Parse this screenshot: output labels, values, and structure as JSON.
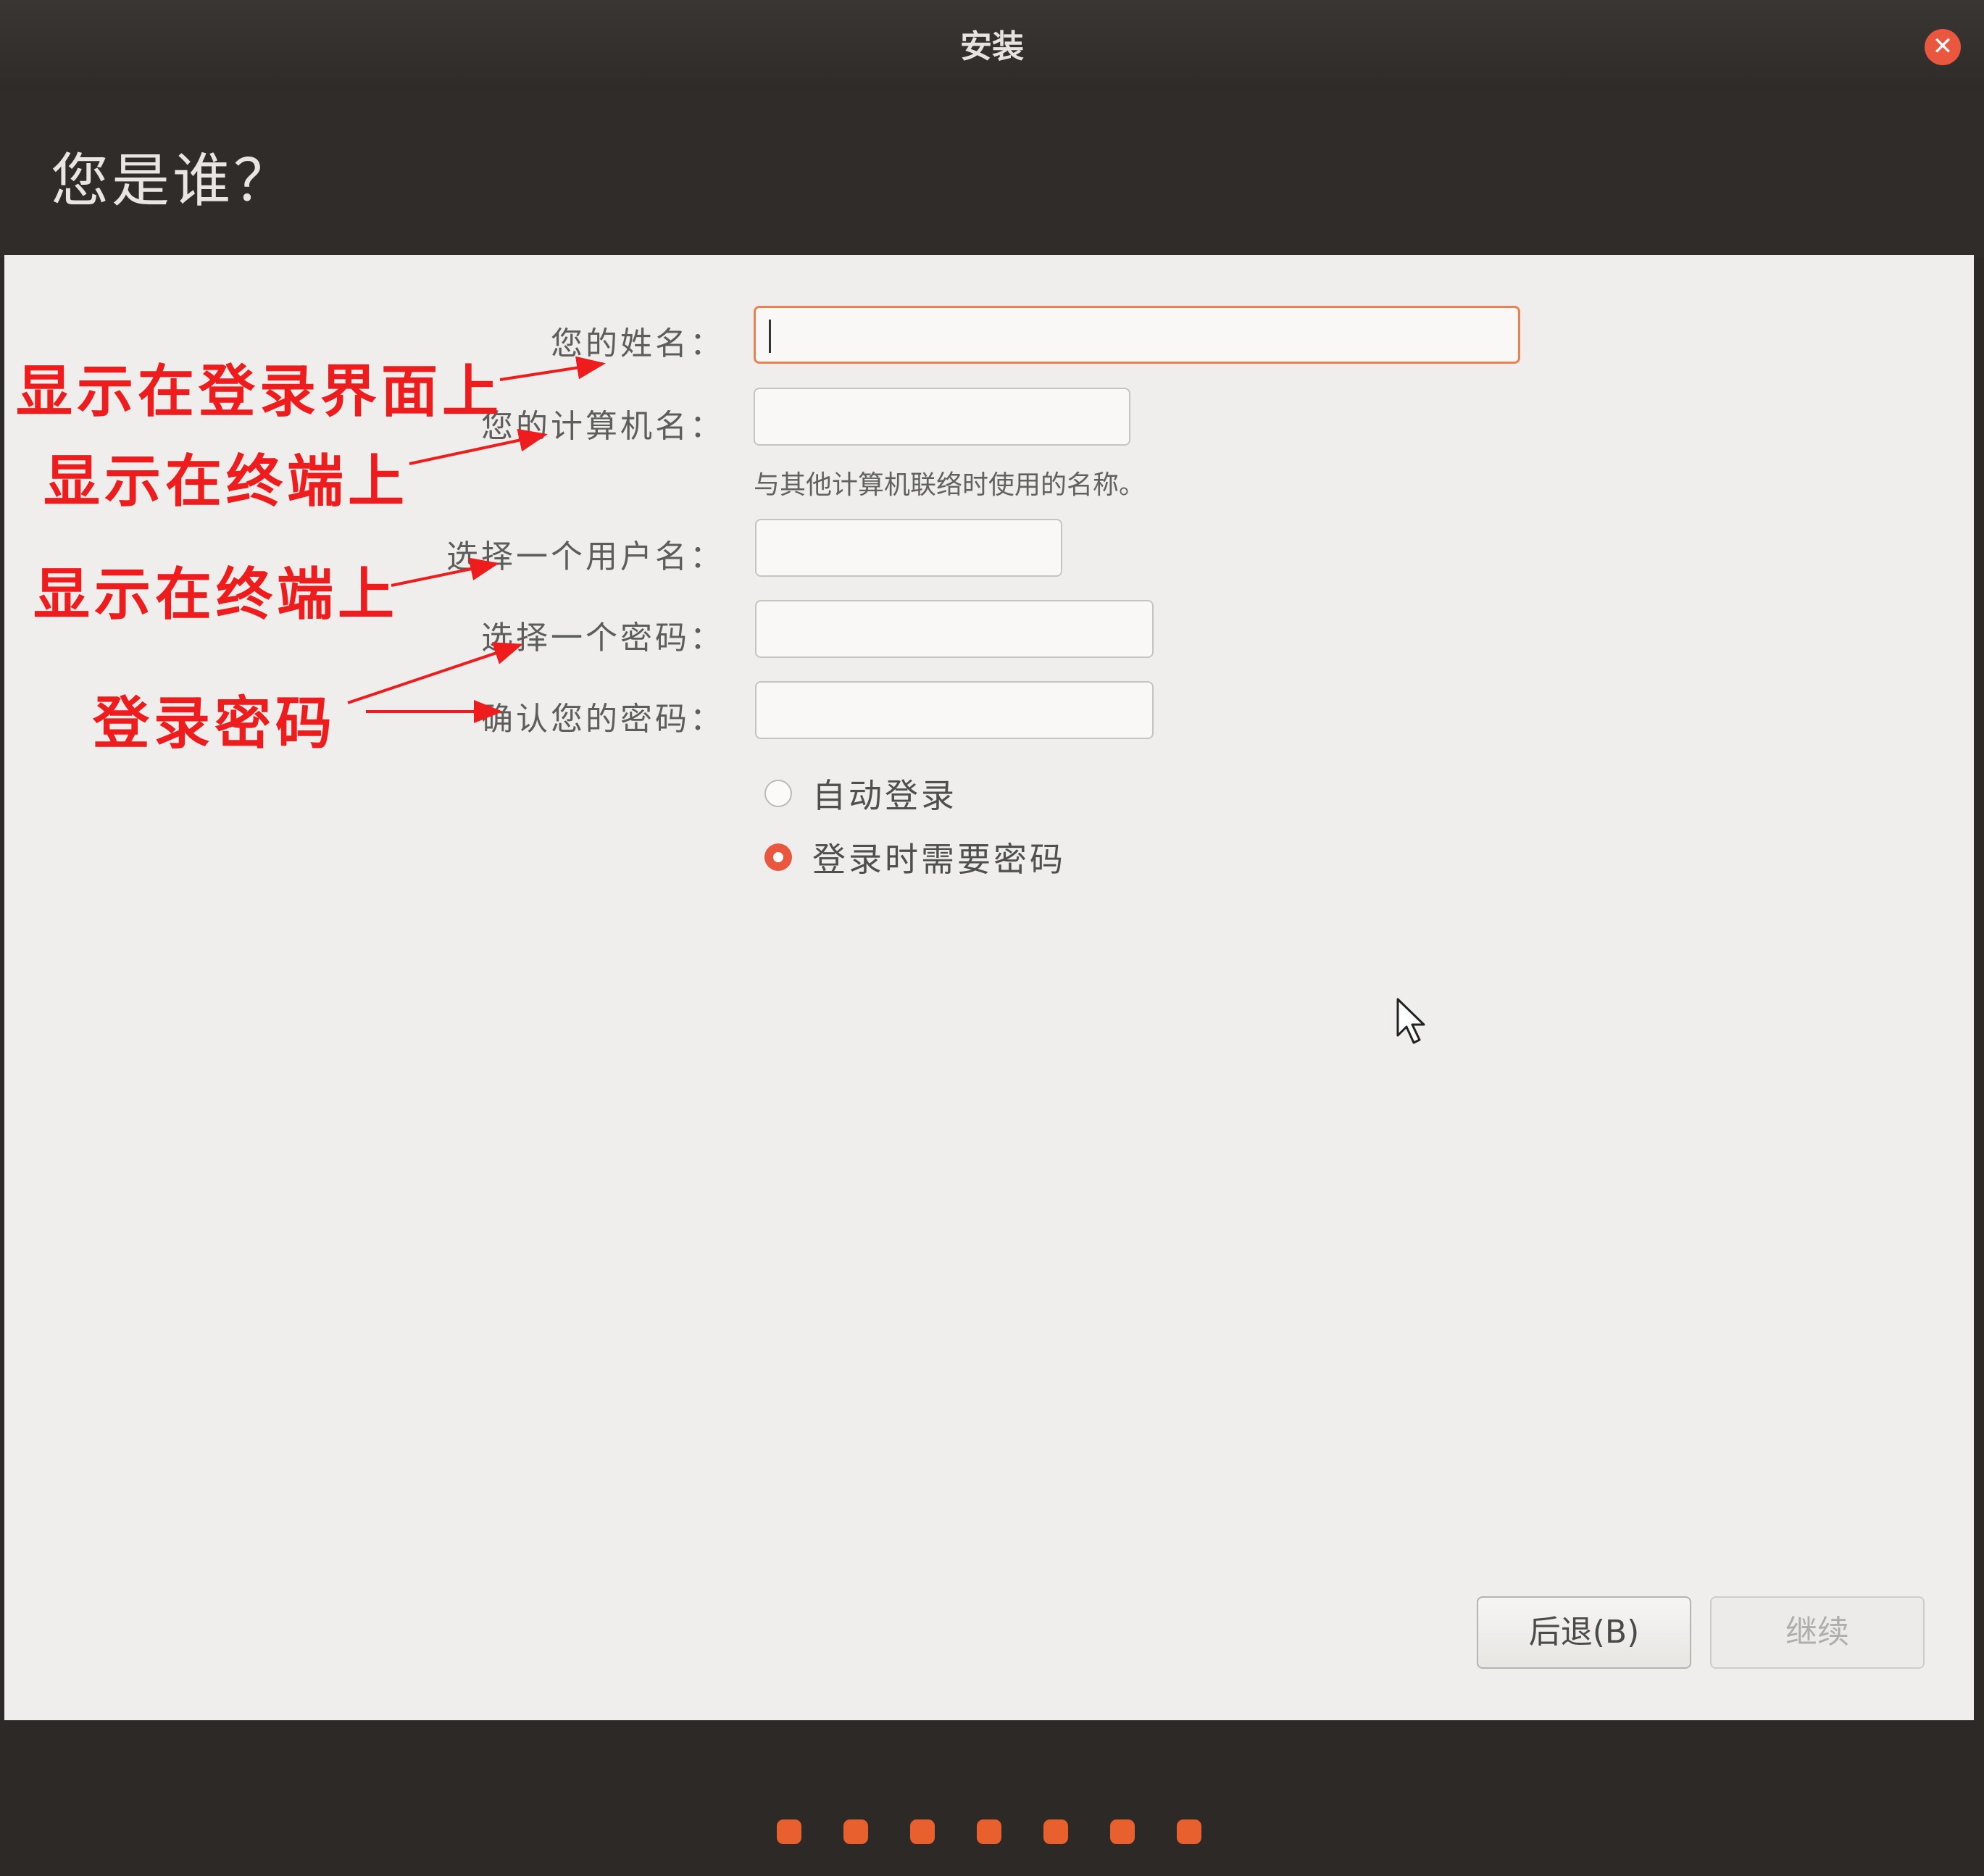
{
  "window": {
    "title": "安装"
  },
  "page": {
    "heading": "您是谁？"
  },
  "form": {
    "name_label": "您的姓名：",
    "computer_label": "您的计算机名：",
    "computer_hint": "与其他计算机联络时使用的名称。",
    "username_label": "选择一个用户名：",
    "password_label": "选择一个密码：",
    "confirm_label": "确认您的密码：",
    "name_value": "",
    "computer_value": "",
    "username_value": "",
    "password_value": "",
    "confirm_value": ""
  },
  "login_options": {
    "auto_login": "自动登录",
    "require_password": "登录时需要密码",
    "selected": "require_password"
  },
  "buttons": {
    "back": "后退(B)",
    "continue": "继续"
  },
  "progress": {
    "steps": 7
  },
  "annotations": {
    "name_note": "显示在登录界面上",
    "computer_note": "显示在终端上",
    "username_note": "显示在终端上",
    "password_note": "登录密码"
  },
  "colors": {
    "accent": "#e9573f",
    "focus_border": "#e9824c",
    "annotation": "#ee1c1c",
    "header_bg": "#2f2c29",
    "panel_bg": "#efeeec"
  },
  "icons": {
    "close": "close-icon",
    "pointer": "mouse-pointer-icon"
  }
}
